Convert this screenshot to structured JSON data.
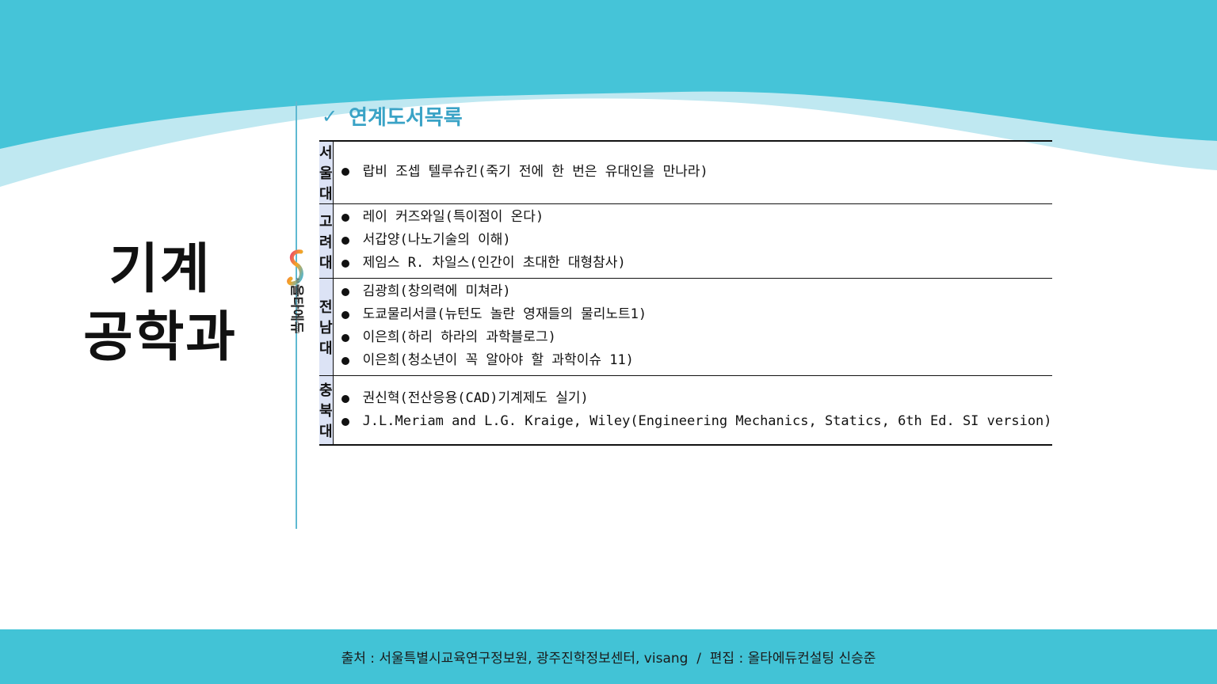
{
  "department": {
    "line1": "기계",
    "line2": "공학과"
  },
  "logo": {
    "name": "올타에듀",
    "sub": "All Ta Education / since2009"
  },
  "section": {
    "check": "✓",
    "title": "연계도서목록"
  },
  "universities": [
    {
      "name": "서울대",
      "books": [
        "랍비 조셉 텔루슈킨(죽기 전에 한 번은 유대인을 만나라)"
      ]
    },
    {
      "name": "고려대",
      "books": [
        "레이 커즈와일(특이점이 온다)",
        "서갑양(나노기술의 이해)",
        "제임스 R. 차일스(인간이 초대한 대형참사)"
      ]
    },
    {
      "name": "전남대",
      "books": [
        "김광희(창의력에 미쳐라)",
        "도쿄물리서클(뉴턴도 놀란 영재들의 물리노트1)",
        "이은희(하리 하라의 과학블로그)",
        "이은희(청소년이 꼭 알아야 할 과학이슈 11)"
      ]
    },
    {
      "name": "충북대",
      "books": [
        "권신혁(전산응용(CAD)기계제도 실기)",
        "J.L.Meriam and L.G. Kraige, Wiley(Engineering Mechanics, Statics, 6th Ed. SI version)"
      ]
    }
  ],
  "footer": {
    "text": "출처 : 서울특별시교육연구정보원, 광주진학정보센터, visang  /  편집 : 올타에듀컨설팅 신승준"
  },
  "colors": {
    "wave_dark": "#45c4d8",
    "wave_light": "#b3e4ef",
    "accent": "#3aa3c6",
    "header_cell": "#dce3f5",
    "footer_bg": "#42c3d6"
  }
}
